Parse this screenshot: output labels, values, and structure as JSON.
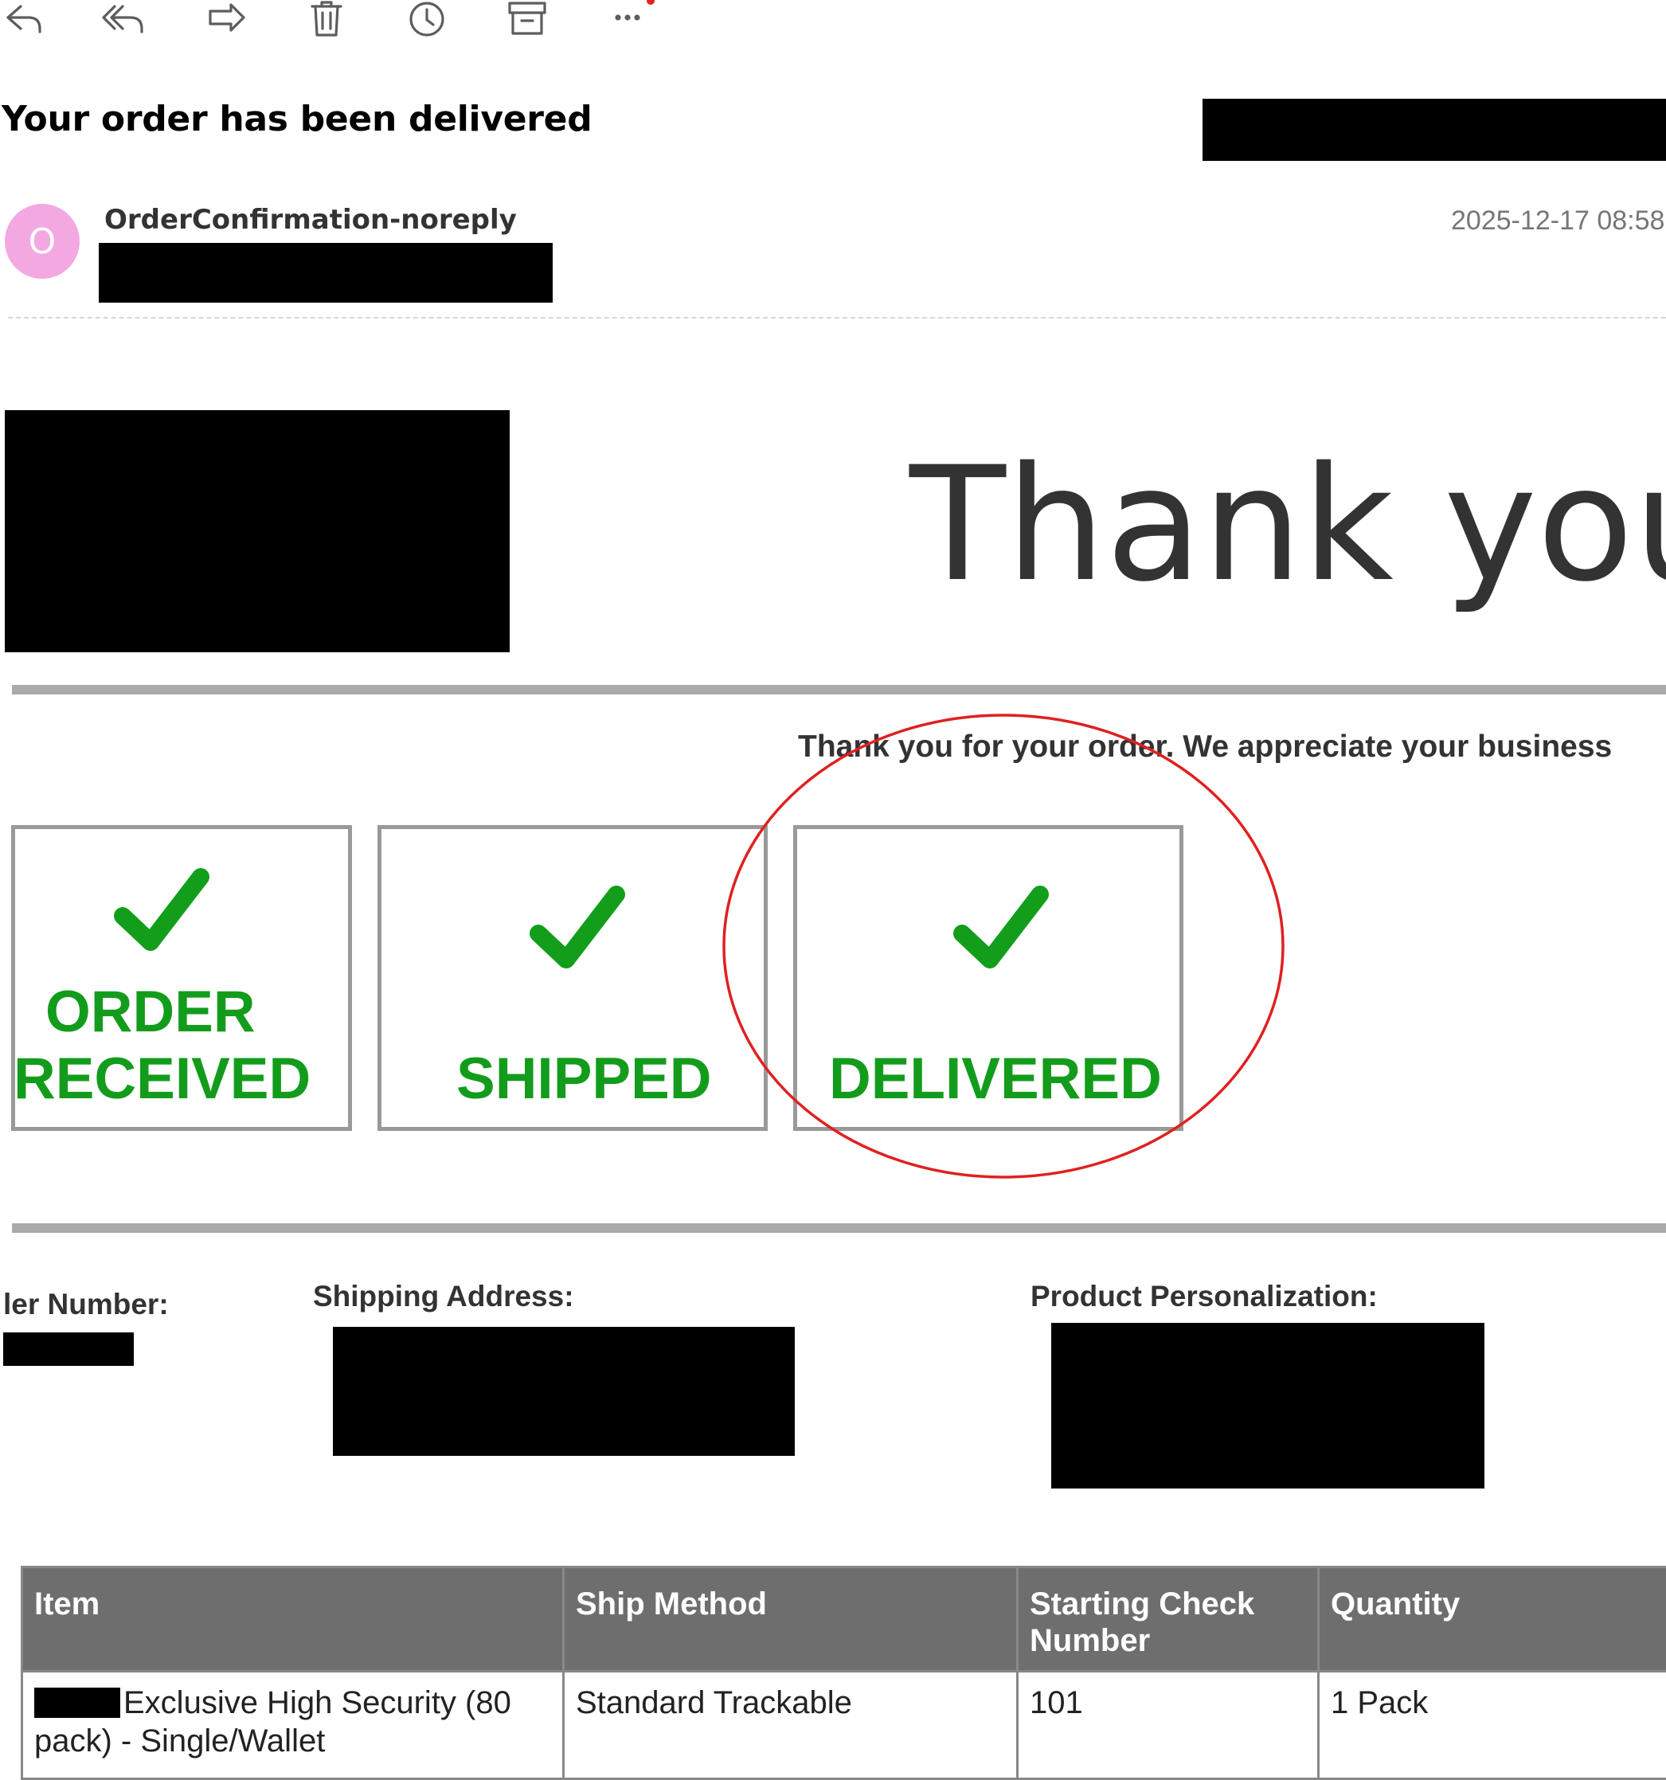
{
  "toolbar": {
    "icons": [
      "reply-icon",
      "reply-all-icon",
      "forward-icon",
      "delete-icon",
      "snooze-icon",
      "archive-icon",
      "more-icon"
    ]
  },
  "email": {
    "subject": "Your order has been delivered",
    "sender_name": "OrderConfirmation-noreply",
    "avatar_letter": "O",
    "avatar_color": "#f3a8e1",
    "timestamp": "2025-12-17 08:58"
  },
  "body": {
    "headline": "Thank you",
    "thanks_line": "Thank you for your order. We appreciate your business",
    "statuses": [
      {
        "line1": "ORDER",
        "line2": "RECEIVED"
      },
      {
        "line1": "",
        "line2": "SHIPPED"
      },
      {
        "line1": "",
        "line2": "DELIVERED"
      }
    ],
    "status_color": "#139c1c",
    "annotation_color": "#e02020",
    "labels": {
      "order_number": "ler Number:",
      "shipping_address": "Shipping Address:",
      "personalization": "Product Personalization:"
    }
  },
  "table": {
    "headers": [
      "Item",
      "Ship Method",
      "Starting Check Number",
      "Quantity"
    ],
    "header_check_line1": "Starting Check",
    "header_check_line2": "Number",
    "rows": [
      {
        "item": "Exclusive High Security (80 pack) - Single/Wallet",
        "ship_method": "Standard Trackable",
        "starting_check": "101",
        "quantity": "1 Pack"
      }
    ]
  }
}
